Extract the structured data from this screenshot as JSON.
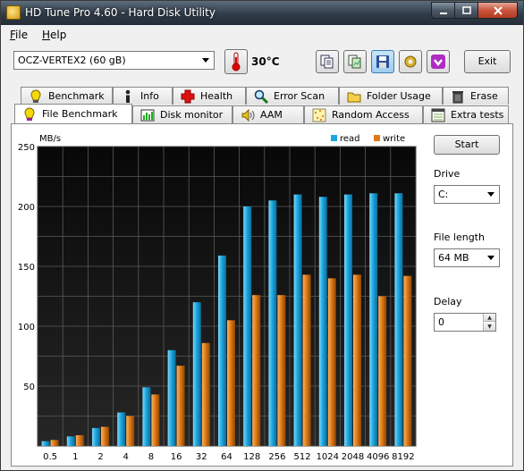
{
  "window": {
    "title": "HD Tune Pro 4.60 - Hard Disk Utility"
  },
  "menu": [
    {
      "label": "File",
      "underline": "F",
      "rest": "ile"
    },
    {
      "label": "Help",
      "underline": "H",
      "rest": "elp"
    }
  ],
  "toolbar": {
    "drive_select": "OCZ-VERTEX2 (60 gB)",
    "temperature": "30°C",
    "exit_label": "Exit"
  },
  "tabs_row1": [
    {
      "label": "Benchmark",
      "icon": "benchmark-icon"
    },
    {
      "label": "Info",
      "icon": "info-icon"
    },
    {
      "label": "Health",
      "icon": "health-cross-icon"
    },
    {
      "label": "Error Scan",
      "icon": "magnifier-icon"
    },
    {
      "label": "Folder Usage",
      "icon": "folder-icon"
    },
    {
      "label": "Erase",
      "icon": "trash-icon"
    }
  ],
  "tabs_row2": [
    {
      "label": "File Benchmark",
      "icon": "file-benchmark-icon",
      "active": true
    },
    {
      "label": "Disk monitor",
      "icon": "disk-monitor-icon"
    },
    {
      "label": "AAM",
      "icon": "speaker-icon"
    },
    {
      "label": "Random Access",
      "icon": "random-access-icon"
    },
    {
      "label": "Extra tests",
      "icon": "extra-tests-icon"
    }
  ],
  "controls": {
    "start_label": "Start",
    "drive_label": "Drive",
    "drive_value": "C:",
    "file_length_label": "File length",
    "file_length_value": "64 MB",
    "delay_label": "Delay",
    "delay_value": "0"
  },
  "colors": {
    "read": "#1ba7e0",
    "write": "#e07a14",
    "plot_bg": "#141414",
    "grid": "#5a5a5a"
  },
  "chart_data": {
    "type": "bar",
    "ylabel": "MB/s",
    "ylim": [
      0,
      250
    ],
    "yticks": [
      50,
      100,
      150,
      200,
      250
    ],
    "categories": [
      "0.5",
      "1",
      "2",
      "4",
      "8",
      "16",
      "32",
      "64",
      "128",
      "256",
      "512",
      "1024",
      "2048",
      "4096",
      "8192"
    ],
    "series": [
      {
        "name": "read",
        "values": [
          4,
          8,
          15,
          28,
          49,
          80,
          120,
          159,
          200,
          205,
          210,
          208,
          210,
          211,
          211
        ]
      },
      {
        "name": "write",
        "values": [
          5,
          9,
          16,
          25,
          43,
          67,
          86,
          105,
          126,
          126,
          143,
          140,
          143,
          125,
          142
        ]
      }
    ],
    "legend": "top-right",
    "grid": true
  }
}
